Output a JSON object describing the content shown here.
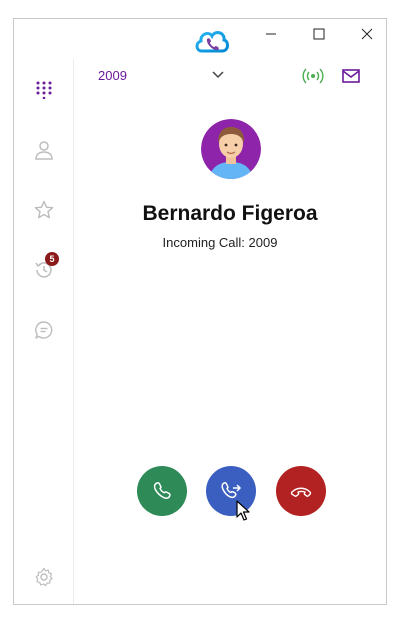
{
  "header": {
    "extension": "2009"
  },
  "caller": {
    "name": "Bernardo Figeroa",
    "status": "Incoming Call: 2009"
  },
  "badges": {
    "recents_count": "5"
  },
  "colors": {
    "accent": "#6a1b9a",
    "answer": "#2e8b57",
    "transfer": "#3b5fc0",
    "decline": "#b22222",
    "badge": "#8b1a1a",
    "signal": "#4caf50"
  },
  "icons": {
    "sidebar": [
      "dialpad-icon",
      "contacts-icon",
      "favorites-icon",
      "recents-icon",
      "chat-icon",
      "settings-icon"
    ],
    "actions": [
      "answer-phone-icon",
      "transfer-call-icon",
      "decline-phone-icon"
    ]
  }
}
